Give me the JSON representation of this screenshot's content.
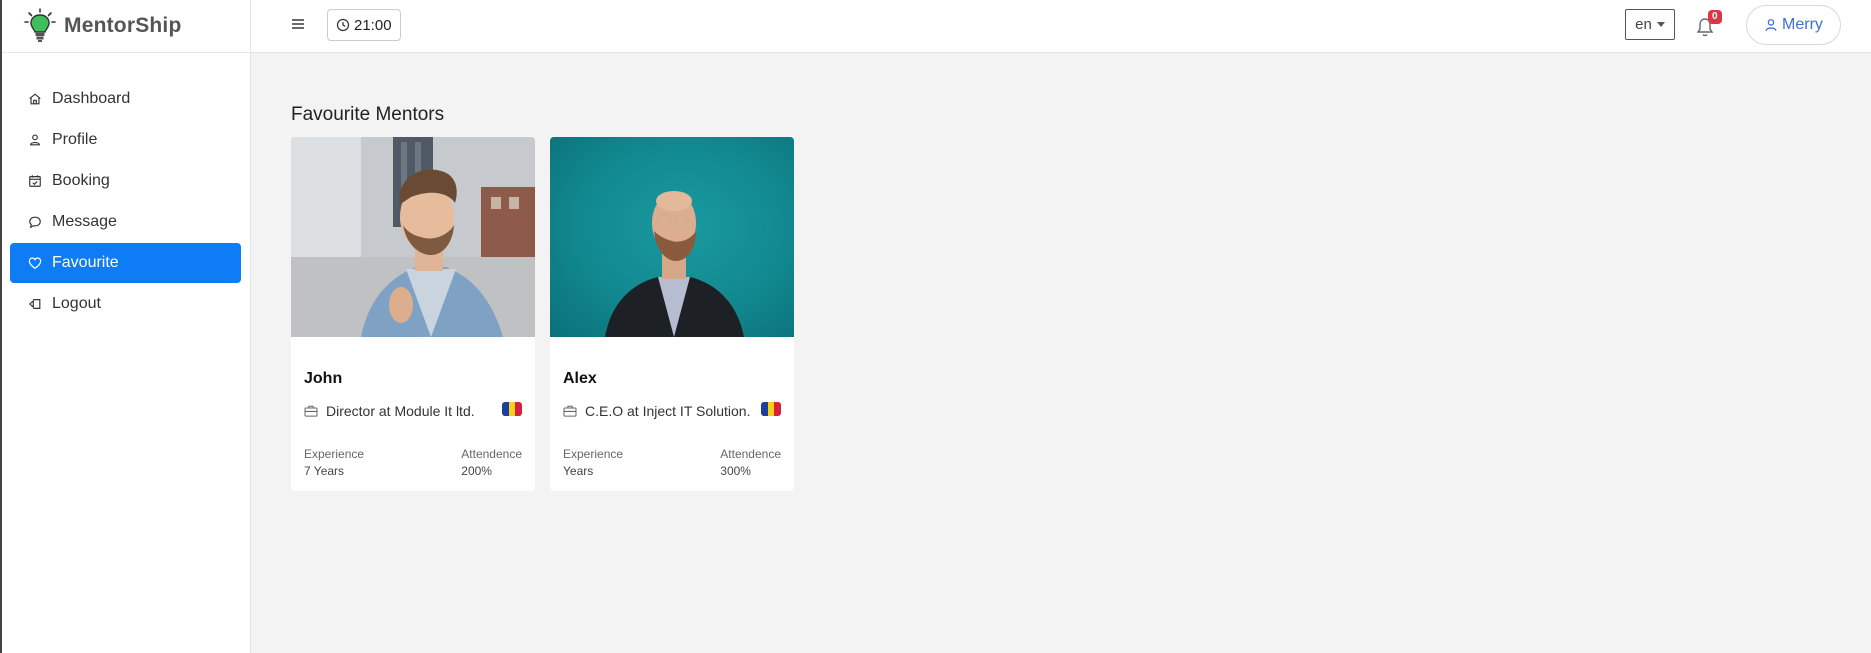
{
  "brand": {
    "name": "MentorShip"
  },
  "sidebar": {
    "items": [
      {
        "label": "Dashboard",
        "icon": "home-icon",
        "active": false
      },
      {
        "label": "Profile",
        "icon": "user-icon",
        "active": false
      },
      {
        "label": "Booking",
        "icon": "calendar-check-icon",
        "active": false
      },
      {
        "label": "Message",
        "icon": "chat-bubble-icon",
        "active": false
      },
      {
        "label": "Favourite",
        "icon": "heart-icon",
        "active": true
      },
      {
        "label": "Logout",
        "icon": "logout-icon",
        "active": false
      }
    ]
  },
  "header": {
    "time": "21:00",
    "language": "en",
    "notification_count": "0",
    "user_name": "Merry"
  },
  "main": {
    "title": "Favourite Mentors",
    "mentors": [
      {
        "name": "John",
        "role": "Director at Module It ltd.",
        "experience_label": "Experience",
        "experience_value": "7 Years",
        "attendance_label": "Attendence",
        "attendance_value": "200%",
        "flag_colors": [
          "#1c3f9e",
          "#f7d116",
          "#d4213d"
        ]
      },
      {
        "name": "Alex",
        "role": "C.E.O at Inject IT Solution.",
        "experience_label": "Experience",
        "experience_value": "Years",
        "attendance_label": "Attendence",
        "attendance_value": "300%",
        "flag_colors": [
          "#1c3f9e",
          "#f7d116",
          "#d4213d"
        ]
      }
    ]
  },
  "colors": {
    "accent": "#0d7cf5",
    "badge": "#dc3545",
    "user_link": "#3d6fd6"
  }
}
